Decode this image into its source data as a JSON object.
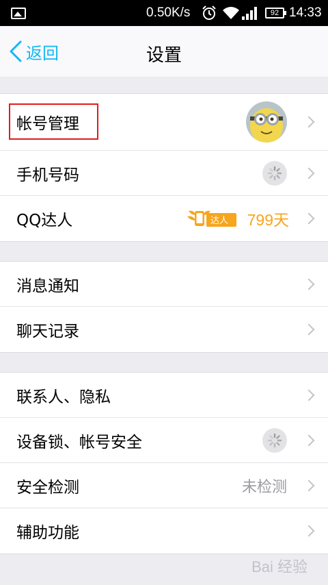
{
  "status_bar": {
    "speed": "0.50K/s",
    "battery": "92",
    "time": "14:33",
    "icons": [
      "picture-icon",
      "alarm-icon",
      "wifi-icon",
      "signal-icon",
      "battery-icon"
    ]
  },
  "header": {
    "back_label": "返回",
    "title": "设置"
  },
  "groups": {
    "account": {
      "account_mgmt": "帐号管理",
      "phone": "手机号码",
      "qq_expert": "QQ达人",
      "qq_badge_text": "达人",
      "qq_days": "799天"
    },
    "messages": {
      "notifications": "消息通知",
      "chat_history": "聊天记录"
    },
    "privacy": {
      "contacts_privacy": "联系人、隐私",
      "device_lock": "设备锁、帐号安全",
      "security_check": "安全检测",
      "security_status": "未检测",
      "accessibility": "辅助功能"
    }
  },
  "watermark": "Bai 经验",
  "colors": {
    "accent": "#12b7f5",
    "badge": "#f7a51d",
    "highlight": "#e21b1b"
  }
}
